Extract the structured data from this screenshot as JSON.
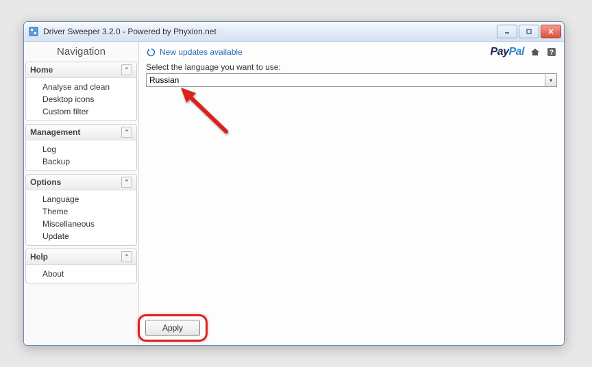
{
  "window": {
    "title": "Driver Sweeper 3.2.0 - Powered by Phyxion.net"
  },
  "sidebar": {
    "title": "Navigation",
    "groups": {
      "home": {
        "label": "Home",
        "items": [
          "Analyse and clean",
          "Desktop icons",
          "Custom filter"
        ]
      },
      "management": {
        "label": "Management",
        "items": [
          "Log",
          "Backup"
        ]
      },
      "options": {
        "label": "Options",
        "items": [
          "Language",
          "Theme",
          "Miscellaneous",
          "Update"
        ]
      },
      "help": {
        "label": "Help",
        "items": [
          "About"
        ]
      }
    }
  },
  "main": {
    "updates_link": "New updates available",
    "paypal_pay": "Pay",
    "paypal_pal": "Pal",
    "language_label": "Select the language you want to use:",
    "language_value": "Russian",
    "apply_label": "Apply"
  }
}
